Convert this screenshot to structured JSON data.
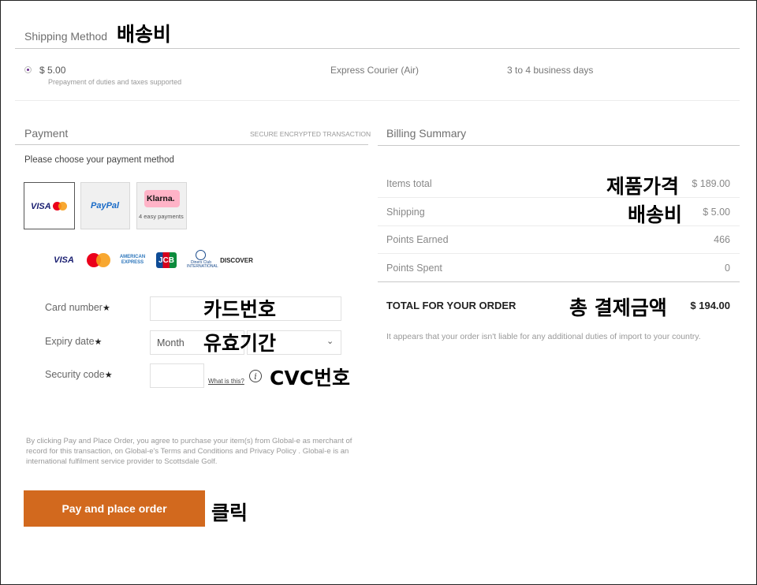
{
  "shipping": {
    "title": "Shipping Method",
    "annotation": "배송비",
    "option": {
      "price": "$ 5.00",
      "note": "Prepayment of duties and taxes supported",
      "carrier": "Express Courier (Air)",
      "eta": "3 to 4 business days"
    }
  },
  "payment": {
    "title": "Payment",
    "secure_label": "SECURE ENCRYPTED TRANSACTION",
    "choose_label": "Please choose your payment method",
    "methods": [
      {
        "name": "VISA",
        "selected": true
      },
      {
        "name": "PayPal",
        "selected": false
      },
      {
        "name": "Klarna.",
        "sub": "4 easy payments",
        "selected": false
      }
    ],
    "card_logos": [
      "VISA",
      "AMERICAN EXPRESS",
      "JCB",
      "Diners Club INTERNATIONAL",
      "DISCOVER"
    ],
    "fields": {
      "card_number_label": "Card number",
      "expiry_label": "Expiry date",
      "month_placeholder": "Month",
      "security_label": "Security code",
      "what_is_this": "What is this?",
      "required_mark": "★"
    },
    "annotations": {
      "card": "카드번호",
      "expiry": "유효기간",
      "cvc": "CVC번호",
      "click": "클릭"
    },
    "legal": {
      "part1": "By clicking Pay and Place Order, you agree to purchase your item(s) from Global-e as merchant of record for this transaction, on Global-e's",
      "terms": "Terms and Conditions",
      "and": "and",
      "privacy": "Privacy Policy",
      "part2": ". Global-e is an international fulfilment service provider to Scottsdale Golf."
    },
    "pay_button": "Pay and place order"
  },
  "billing": {
    "title": "Billing Summary",
    "rows": [
      {
        "label": "Items total",
        "value": "$ 189.00",
        "annotation": "제품가격"
      },
      {
        "label": "Shipping",
        "value": "$ 5.00",
        "annotation": "배송비"
      },
      {
        "label": "Points Earned",
        "value": "466"
      },
      {
        "label": "Points Spent",
        "value": "0"
      }
    ],
    "total_label": "TOTAL FOR YOUR ORDER",
    "total_annotation": "총 결제금액",
    "total_value": "$ 194.00",
    "notice": "It appears that your order isn't liable for any additional duties of import to your country."
  },
  "colors": {
    "accent_button": "#d2691e",
    "radio_selected": "#6a2a8c"
  }
}
